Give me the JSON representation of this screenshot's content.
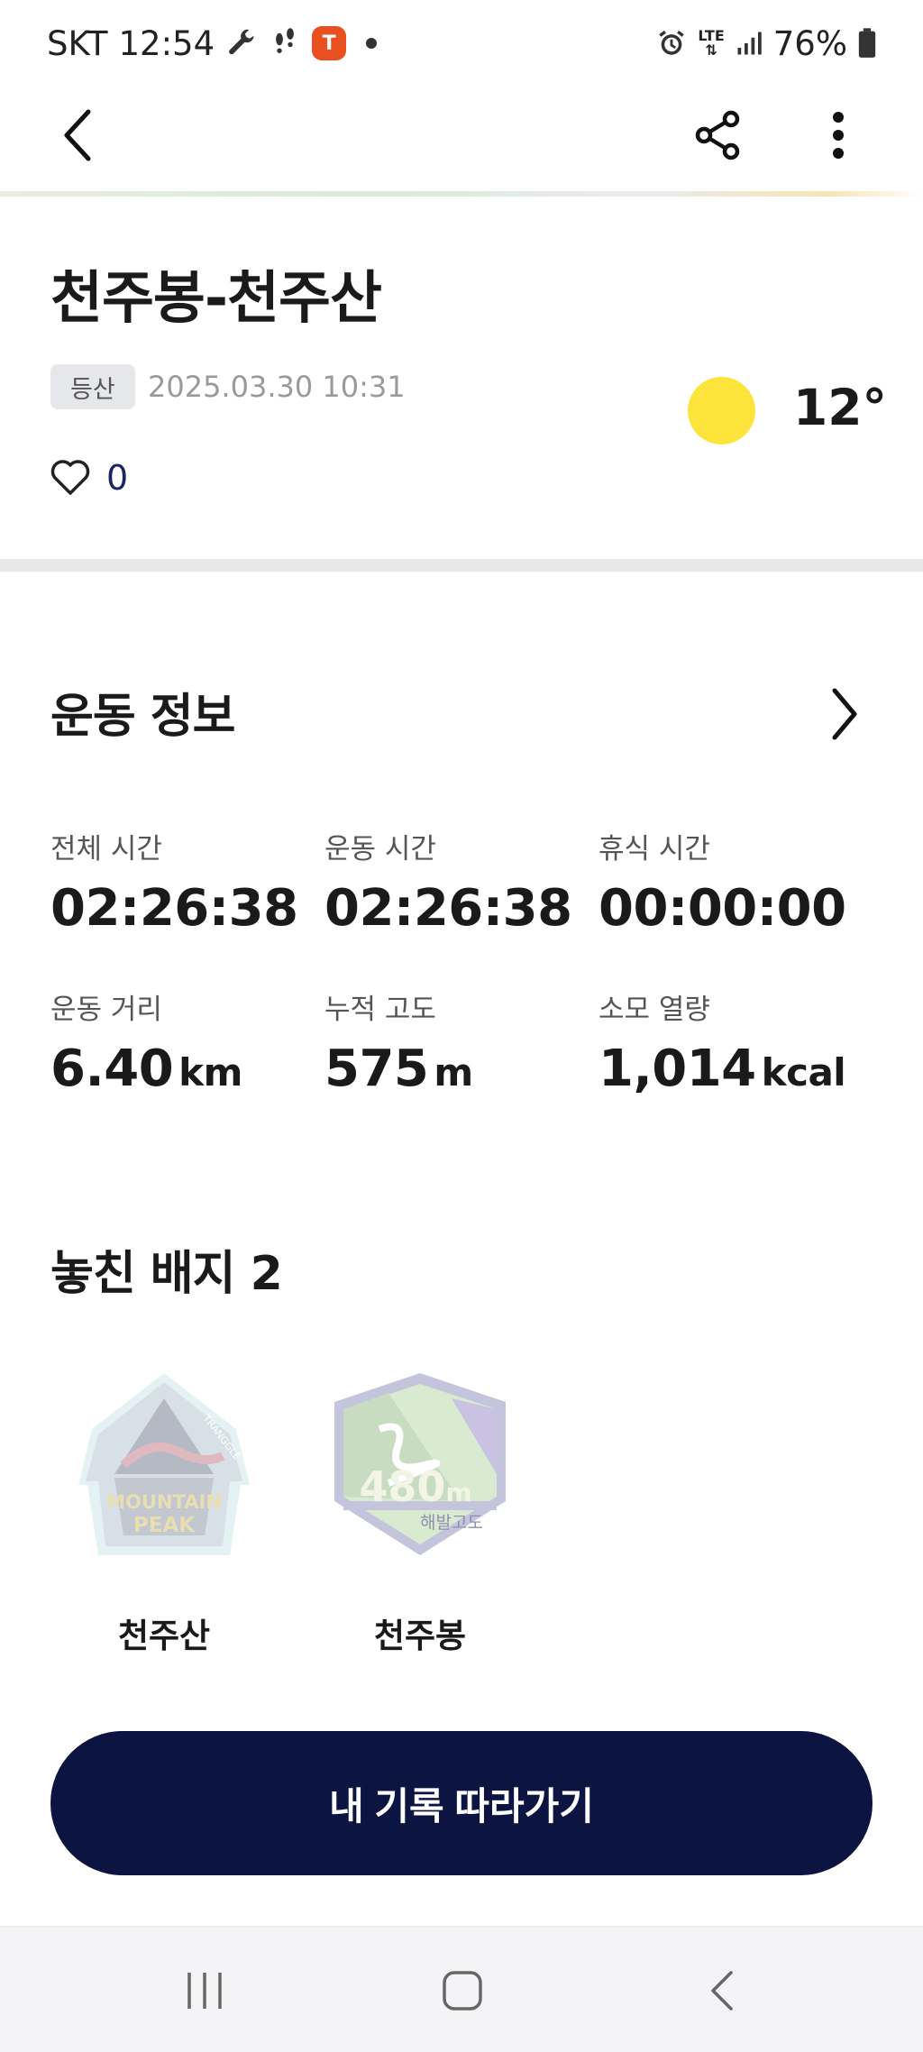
{
  "status_bar": {
    "carrier": "SKT",
    "time": "12:54",
    "app_badge_glyph": "T",
    "network": "LTE",
    "battery": "76%"
  },
  "record": {
    "title": "천주봉-천주산",
    "category_tag": "등산",
    "datetime": "2025.03.30 10:31",
    "temperature": "12°",
    "like_count": "0"
  },
  "exercise": {
    "section_title": "운동 정보",
    "stats": [
      {
        "label": "전체 시간",
        "value": "02:26:38",
        "unit": ""
      },
      {
        "label": "운동 시간",
        "value": "02:26:38",
        "unit": ""
      },
      {
        "label": "휴식 시간",
        "value": "00:00:00",
        "unit": ""
      },
      {
        "label": "운동 거리",
        "value": "6.40",
        "unit": "km"
      },
      {
        "label": "누적 고도",
        "value": "575",
        "unit": "m"
      },
      {
        "label": "소모 열량",
        "value": "1,014",
        "unit": "kcal"
      }
    ]
  },
  "badges": {
    "section_title": "놓친 배지 2",
    "items": [
      {
        "name": "천주산",
        "art_line1": "MOUNTAIN",
        "art_line2": "PEAK",
        "art_arc": "TRANGGLE"
      },
      {
        "name": "천주봉",
        "art_value": "480",
        "art_unit": "m",
        "art_caption": "해발고도"
      }
    ]
  },
  "cta": {
    "label": "내 기록 따라가기"
  },
  "colors": {
    "accent_navy": "#0c1441",
    "sun_yellow": "#fde43a",
    "app_badge": "#e8501f"
  }
}
